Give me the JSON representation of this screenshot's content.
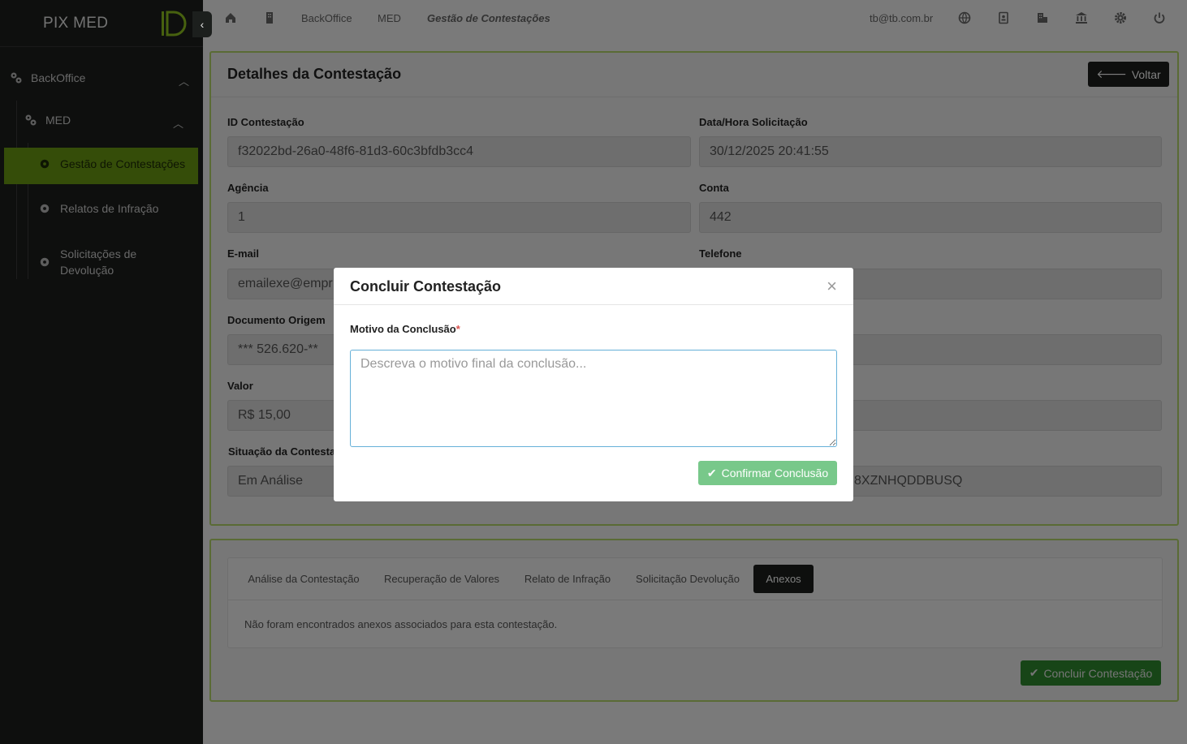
{
  "app": {
    "title": "PIX MED"
  },
  "sidebar": {
    "items": [
      {
        "label": "BackOffice"
      },
      {
        "label": "MED"
      },
      {
        "label": "Gestão de Contestações"
      },
      {
        "label": "Relatos de Infração"
      },
      {
        "label": "Solicitações de Devolução"
      }
    ]
  },
  "topbar": {
    "breadcrumb": [
      "BackOffice",
      "MED",
      "Gestão de Contestações"
    ],
    "user_email": "tb@tb.com.br",
    "icons": [
      "home-icon",
      "building-icon",
      "globe-icon",
      "contact-book-icon",
      "buildings-icon",
      "bank-icon",
      "gear-icon",
      "power-icon"
    ]
  },
  "details": {
    "title": "Detalhes da Contestação",
    "back_label": "Voltar",
    "fields": {
      "id_label": "ID Contestação",
      "id_value": "f32022bd-26a0-48f6-81d3-60c3bfdb3cc4",
      "datetime_label": "Data/Hora Solicitação",
      "datetime_value": "30/12/2025 20:41:55",
      "agencia_label": "Agência",
      "agencia_value": "1",
      "conta_label": "Conta",
      "conta_value": "442",
      "email_label": "E-mail",
      "email_value": "emailexe@empr",
      "telefone_label": "Telefone",
      "telefone_value": "",
      "doc_label": "Documento Origem",
      "doc_value": "*** 526.620-**",
      "valor_label": "Valor",
      "valor_value": "R$ 15,00",
      "situacao_label": "Situação da Contesta",
      "situacao_value": "Em Análise",
      "e2e_value": "8XZNHQDDBUSQ"
    }
  },
  "tabs": {
    "items": [
      "Análise da Contestação",
      "Recuperação de Valores",
      "Relato de Infração",
      "Solicitação Devolução",
      "Anexos"
    ],
    "active": "Anexos",
    "message": "Não foram encontrados anexos associados para esta contestação.",
    "conclude_label": "Concluir Contestação"
  },
  "modal": {
    "title": "Concluir Contestação",
    "close": "×",
    "field_label": "Motivo da Conclusão",
    "required_mark": "*",
    "placeholder": "Descreva o motivo final da conclusão...",
    "confirm_label": "Confirmar Conclusão"
  },
  "colors": {
    "accent": "#6a9a12",
    "sidebar_bg": "#1c1f1d",
    "card_border": "#b5d66a",
    "success": "#2f8a2f"
  }
}
